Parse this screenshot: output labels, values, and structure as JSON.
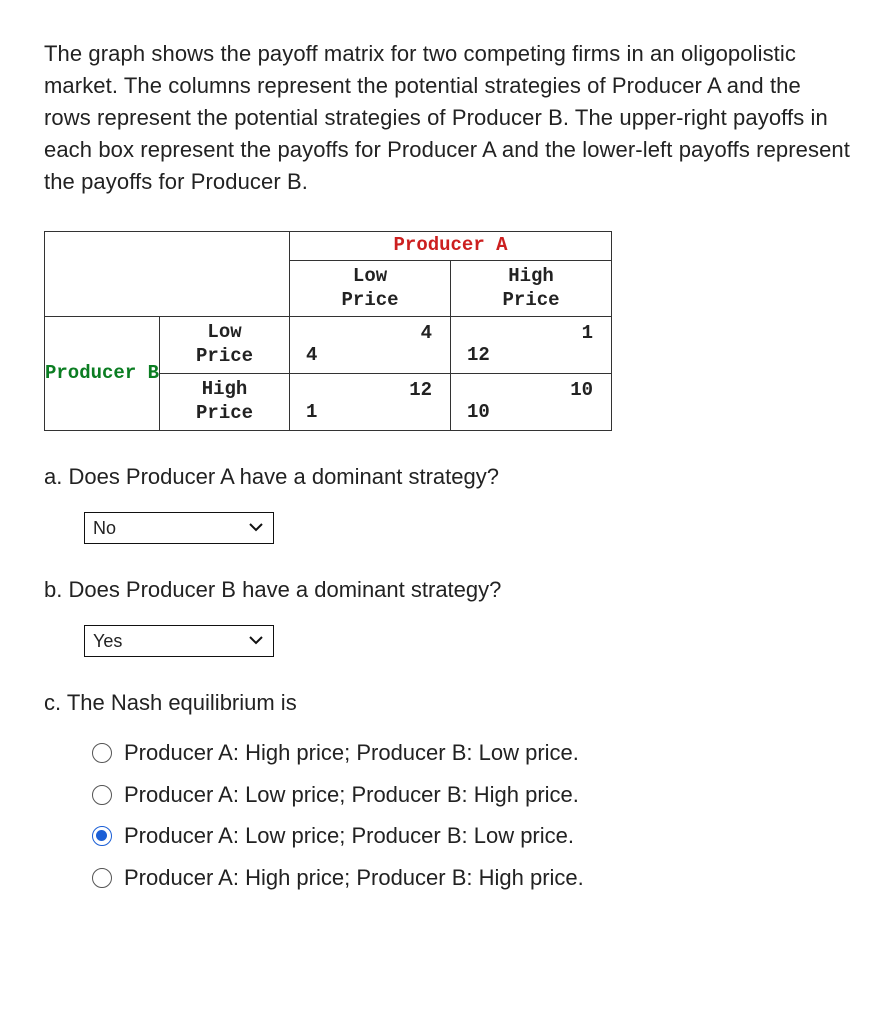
{
  "intro": "The graph shows the payoff matrix for two competing firms in an oligopolistic market. The columns represent the potential strategies of Producer A and the rows represent the potential strategies of Producer B. The upper-right payoffs in each box represent the payoffs for Producer A and the lower-left payoffs represent the payoffs for Producer B.",
  "matrix": {
    "col_player": "Producer A",
    "row_player": "Producer B",
    "col_strategies": [
      "Low\nPrice",
      "High\nPrice"
    ],
    "row_strategies": [
      "Low\nPrice",
      "High\nPrice"
    ],
    "cells": [
      [
        {
          "a": "4",
          "b": "4"
        },
        {
          "a": "1",
          "b": "12"
        }
      ],
      [
        {
          "a": "12",
          "b": "1"
        },
        {
          "a": "10",
          "b": "10"
        }
      ]
    ]
  },
  "partA": {
    "text": "a. Does Producer A have a dominant strategy?",
    "selected": "No"
  },
  "partB": {
    "text": "b. Does Producer B have a dominant strategy?",
    "selected": "Yes"
  },
  "partC": {
    "text": "c. The Nash equilibrium is",
    "options": [
      "Producer A: High price; Producer B: Low price.",
      "Producer A: Low price; Producer B: High price.",
      "Producer A: Low price; Producer B: Low price.",
      "Producer A: High price; Producer B: High price."
    ],
    "selected_index": 2
  },
  "chart_data": {
    "type": "table",
    "title": "Payoff matrix — oligopoly pricing game",
    "row_player": "Producer B",
    "col_player": "Producer A",
    "row_strategies": [
      "Low Price",
      "High Price"
    ],
    "col_strategies": [
      "Low Price",
      "High Price"
    ],
    "payoffs": {
      "B_low_A_low": {
        "A": 4,
        "B": 4
      },
      "B_low_A_high": {
        "A": 1,
        "B": 12
      },
      "B_high_A_low": {
        "A": 12,
        "B": 1
      },
      "B_high_A_high": {
        "A": 10,
        "B": 10
      }
    }
  }
}
